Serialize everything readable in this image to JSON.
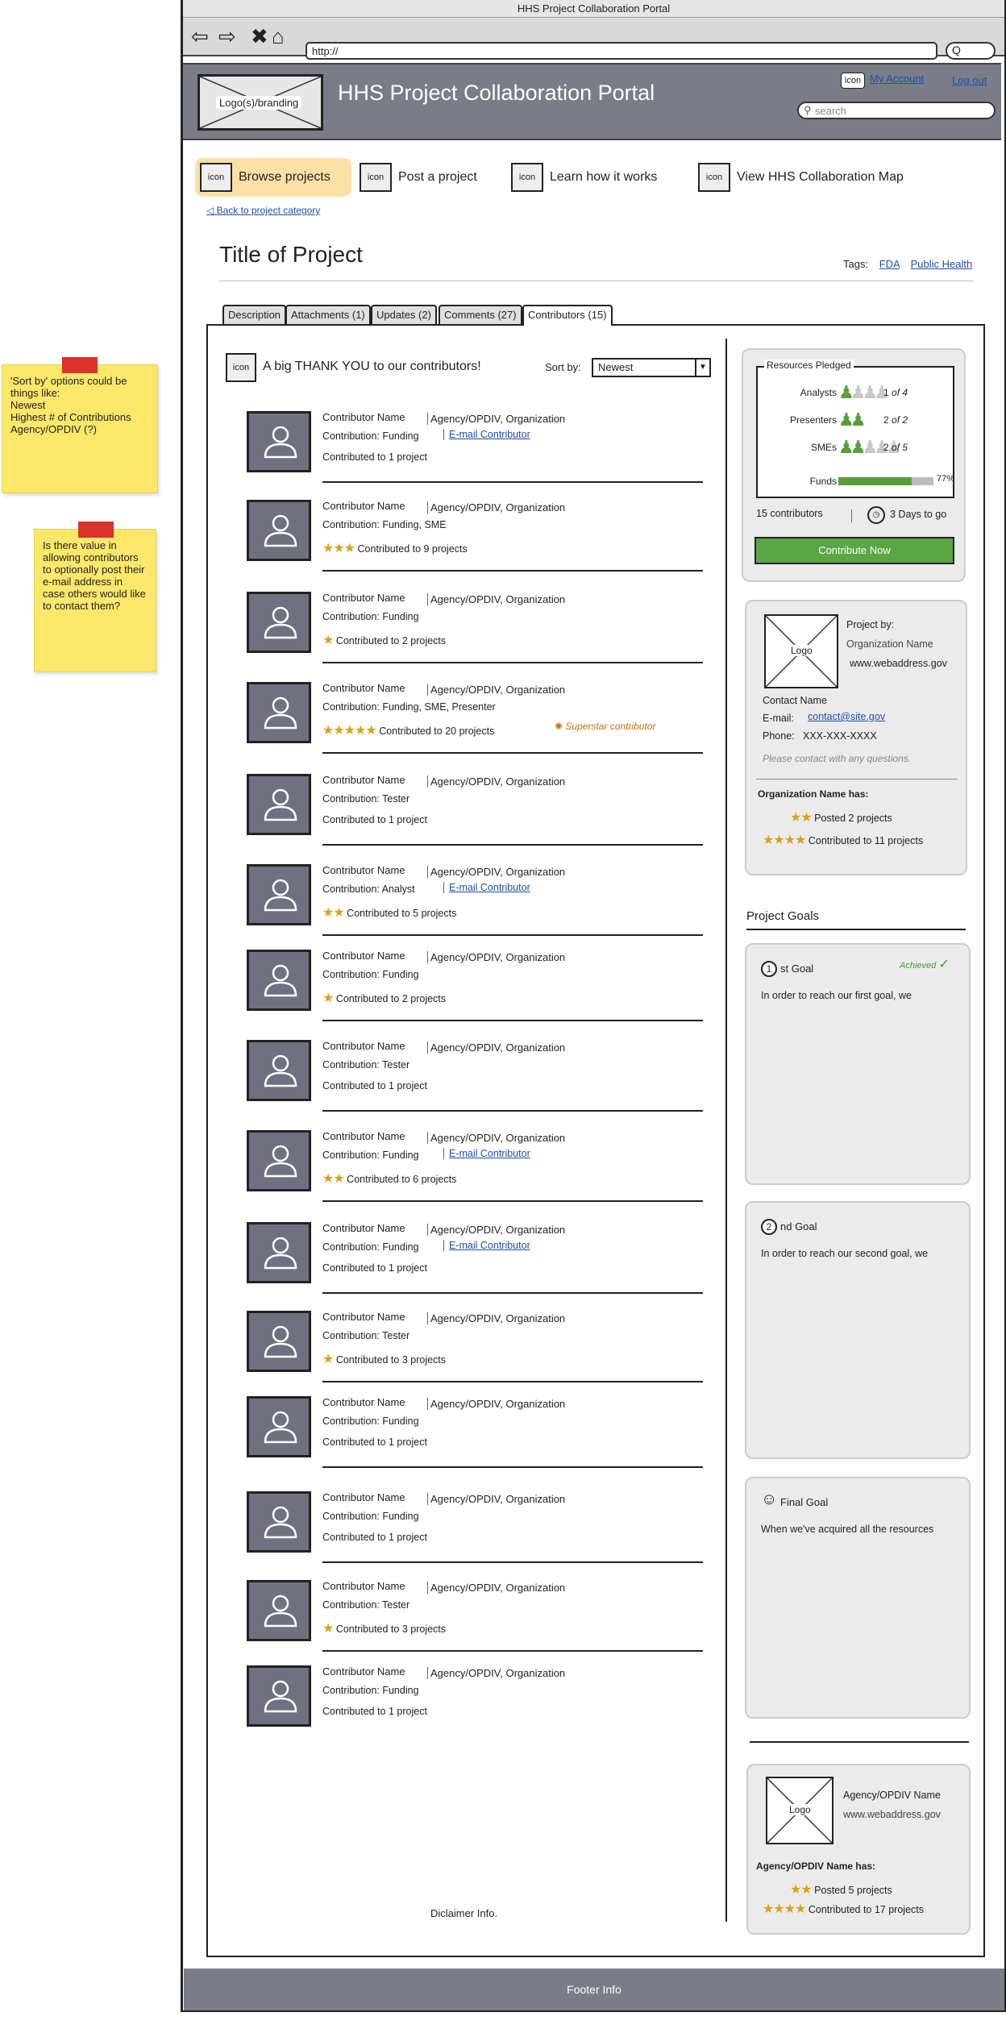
{
  "notes": {
    "sort_note": "'Sort by' options could be things like:\nNewest\nHighest # of Contributions\nAgency/OPDIV (?)",
    "email_note": "Is there value in allowing contributors to optionally post their e-mail address in case others would like to contact them?"
  },
  "browser": {
    "window_title": "HHS Project Collaboration Portal",
    "url": "http://",
    "search_glyph": "Q"
  },
  "header": {
    "logo_label": "Logo(s)/branding",
    "title": "HHS Project Collaboration Portal",
    "icon_label": "icon",
    "my_account": "My Account",
    "logout": "Log out",
    "search_placeholder": "search"
  },
  "nav": {
    "icon_label": "icon",
    "items": [
      {
        "label": "Browse projects"
      },
      {
        "label": "Post a project"
      },
      {
        "label": "Learn how it works"
      },
      {
        "label": "View HHS Collaboration Map"
      }
    ],
    "back_link": "Back to project category"
  },
  "project": {
    "title": "Title of Project",
    "tags_label": "Tags:",
    "tags": [
      "FDA",
      "Public Health"
    ]
  },
  "tabs": [
    {
      "label": "Description"
    },
    {
      "label": "Attachments (1)"
    },
    {
      "label": "Updates (2)"
    },
    {
      "label": "Comments (27)"
    },
    {
      "label": "Contributors (15)",
      "active": true
    }
  ],
  "contributors_section": {
    "icon_label": "icon",
    "thanks": "A big THANK YOU to our contributors!",
    "sort_label": "Sort by:",
    "sort_value": "Newest",
    "disclaimer": "Diclaimer Info."
  },
  "contributors": [
    {
      "name": "Contributor Name",
      "agency": "Agency/OPDIV, Organization",
      "contribution": "Contribution: Funding",
      "email": "E-mail Contributor",
      "stars": 0,
      "count": "Contributed to 1 project"
    },
    {
      "name": "Contributor Name",
      "agency": "Agency/OPDIV, Organization",
      "contribution": "Contribution: Funding, SME",
      "email": "",
      "stars": 3,
      "count": "Contributed to 9 projects"
    },
    {
      "name": "Contributor Name",
      "agency": "Agency/OPDIV, Organization",
      "contribution": "Contribution: Funding",
      "email": "",
      "stars": 1,
      "count": "Contributed to 2 projects"
    },
    {
      "name": "Contributor Name",
      "agency": "Agency/OPDIV, Organization",
      "contribution": "Contribution: Funding, SME, Presenter",
      "email": "",
      "stars": 5,
      "count": "Contributed to 20 projects",
      "badge": "Superstar contributor"
    },
    {
      "name": "Contributor Name",
      "agency": "Agency/OPDIV, Organization",
      "contribution": "Contribution: Tester",
      "email": "",
      "stars": 0,
      "count": "Contributed to 1 project"
    },
    {
      "name": "Contributor Name",
      "agency": "Agency/OPDIV, Organization",
      "contribution": "Contribution: Analyst",
      "email": "E-mail Contributor",
      "stars": 2,
      "count": "Contributed to 5 projects"
    },
    {
      "name": "Contributor Name",
      "agency": "Agency/OPDIV, Organization",
      "contribution": "Contribution: Funding",
      "email": "",
      "stars": 1,
      "count": "Contributed to 2 projects"
    },
    {
      "name": "Contributor Name",
      "agency": "Agency/OPDIV, Organization",
      "contribution": "Contribution: Tester",
      "email": "",
      "stars": 0,
      "count": "Contributed to 1 project"
    },
    {
      "name": "Contributor Name",
      "agency": "Agency/OPDIV, Organization",
      "contribution": "Contribution: Funding",
      "email": "E-mail Contributor",
      "stars": 2,
      "count": "Contributed to 6 projects"
    },
    {
      "name": "Contributor Name",
      "agency": "Agency/OPDIV, Organization",
      "contribution": "Contribution: Funding",
      "email": "E-mail Contributor",
      "stars": 0,
      "count": "Contributed to 1 project"
    },
    {
      "name": "Contributor Name",
      "agency": "Agency/OPDIV, Organization",
      "contribution": "Contribution: Tester",
      "email": "",
      "stars": 1,
      "count": "Contributed to 3 projects"
    },
    {
      "name": "Contributor Name",
      "agency": "Agency/OPDIV, Organization",
      "contribution": "Contribution: Funding",
      "email": "",
      "stars": 0,
      "count": "Contributed to 1 project"
    },
    {
      "name": "Contributor Name",
      "agency": "Agency/OPDIV, Organization",
      "contribution": "Contribution: Funding",
      "email": "",
      "stars": 0,
      "count": "Contributed to 1 project"
    },
    {
      "name": "Contributor Name",
      "agency": "Agency/OPDIV, Organization",
      "contribution": "Contribution: Tester",
      "email": "",
      "stars": 1,
      "count": "Contributed to 3 projects"
    },
    {
      "name": "Contributor Name",
      "agency": "Agency/OPDIV, Organization",
      "contribution": "Contribution: Funding",
      "email": "",
      "stars": 0,
      "count": "Contributed to 1 project"
    }
  ],
  "resources": {
    "legend": "Resources Pledged",
    "rows": [
      {
        "label": "Analysts",
        "filled": 1,
        "total": 4,
        "filled_text": "1",
        "of_text": "of 4"
      },
      {
        "label": "Presenters",
        "filled": 2,
        "total": 2,
        "filled_text": "2",
        "of_text": "of 2"
      },
      {
        "label": "SMEs",
        "filled": 2,
        "total": 5,
        "filled_text": "2",
        "of_text": "of 5"
      }
    ],
    "funds_label": "Funds",
    "funds_fraction": 0.77,
    "funds_pct": "77%",
    "contributors": "15 contributors",
    "days_left": "3 Days to go",
    "button": "Contribute Now",
    "colors": {
      "filled": "#5a9e3c",
      "empty": "#c8c8c8",
      "button": "#5aa645"
    }
  },
  "org": {
    "logo_label": "Logo",
    "project_by": "Project by:",
    "name": "Organization Name",
    "web": "www.webaddress.gov",
    "contact_name": "Contact Name",
    "email_label": "E-mail:",
    "email": "contact@site.gov",
    "phone_label": "Phone:",
    "phone": "XXX-XXX-XXXX",
    "please": "Please contact with any questions.",
    "has_label": "Organization Name has:",
    "posted_stars": 2,
    "posted": "Posted 2 projects",
    "contributed_stars": 4,
    "contributed": "Contributed to 11 projects"
  },
  "goals": {
    "title": "Project Goals",
    "items": [
      {
        "num": "1",
        "head": "st   Goal",
        "body": "In order to reach our first goal, we",
        "status": "Achieved"
      },
      {
        "num": "2",
        "head": "nd   Goal",
        "body": "In order to reach our second goal, we"
      },
      {
        "num": "",
        "head": "Final Goal",
        "body": "When we've acquired all the resources"
      }
    ]
  },
  "agency": {
    "logo_label": "Logo",
    "name": "Agency/OPDIV Name",
    "web": "www.webaddress.gov",
    "has_label": "Agency/OPDIV Name has:",
    "posted_stars": 2,
    "posted": "Posted 5 projects",
    "contributed_stars": 4,
    "contributed": "Contributed to 17 projects"
  },
  "footer": {
    "text": "Footer Info"
  }
}
